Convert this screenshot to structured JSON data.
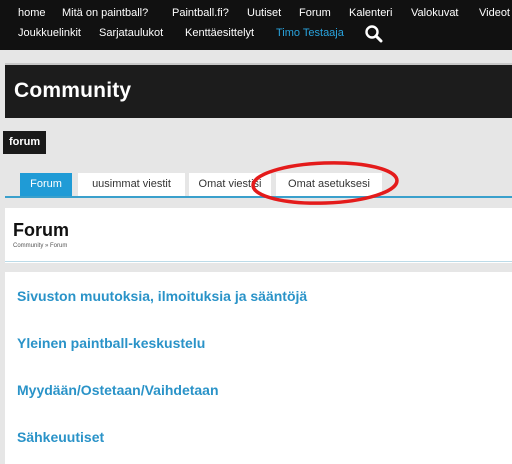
{
  "nav": {
    "row1": [
      "home",
      "Mitä on paintball?",
      "Paintball.fi?",
      "Uutiset",
      "Forum",
      "Kalenteri",
      "Valokuvat",
      "Videot"
    ],
    "row2": [
      "Joukkuelinkit",
      "Sarjataulukot",
      "Kenttäesittelyt",
      "Timo Testaaja"
    ],
    "active_item": "Timo Testaaja"
  },
  "header": {
    "community_title": "Community",
    "forum_label": "forum"
  },
  "tabs": [
    {
      "label": "Forum",
      "active": true
    },
    {
      "label": "uusimmat viestit",
      "active": false
    },
    {
      "label": "Omat viestisi",
      "active": false
    },
    {
      "label": "Omat asetuksesi",
      "active": false
    }
  ],
  "page": {
    "title": "Forum",
    "breadcrumb": "Community » Forum"
  },
  "forums": [
    "Sivuston muutoksia, ilmoituksia ja sääntöjä",
    "Yleinen paintball-keskustelu",
    "Myydään/Ostetaan/Vaihdetaan",
    "Sähkeuutiset"
  ],
  "colors": {
    "accent": "#1f9bd6",
    "link": "#2a93c8",
    "highlight_circle": "#e41b1b",
    "dark_bar": "#1c1c1c"
  },
  "icons": {
    "search": "search-icon"
  }
}
